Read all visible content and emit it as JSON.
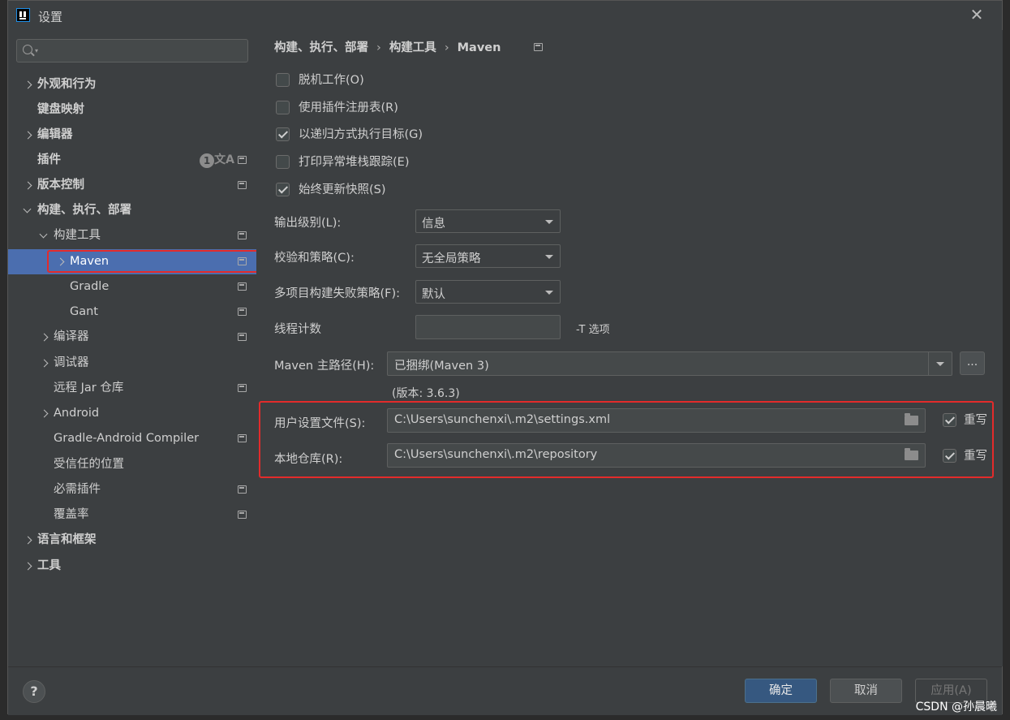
{
  "window": {
    "title": "设置"
  },
  "sidebar": {
    "search_placeholder": "",
    "items": [
      {
        "label": "外观和行为",
        "expand": "right",
        "bold": true
      },
      {
        "label": "键盘映射",
        "expand": "none",
        "bold": true
      },
      {
        "label": "编辑器",
        "expand": "right",
        "bold": true
      },
      {
        "label": "插件",
        "expand": "none",
        "bold": true,
        "badge": "1"
      },
      {
        "label": "版本控制",
        "expand": "right",
        "bold": true
      },
      {
        "label": "构建、执行、部署",
        "expand": "down",
        "bold": true
      },
      {
        "label": "构建工具",
        "expand": "down"
      },
      {
        "label": "Maven",
        "expand": "right",
        "selected": true
      },
      {
        "label": "Gradle",
        "expand": "none"
      },
      {
        "label": "Gant",
        "expand": "none"
      },
      {
        "label": "编译器",
        "expand": "right"
      },
      {
        "label": "调试器",
        "expand": "right"
      },
      {
        "label": "远程 Jar 仓库",
        "expand": "none"
      },
      {
        "label": "Android",
        "expand": "right"
      },
      {
        "label": "Gradle-Android Compiler",
        "expand": "none"
      },
      {
        "label": "受信任的位置",
        "expand": "none"
      },
      {
        "label": "必需插件",
        "expand": "none"
      },
      {
        "label": "覆盖率",
        "expand": "none"
      },
      {
        "label": "语言和框架",
        "expand": "right",
        "bold": true
      },
      {
        "label": "工具",
        "expand": "right",
        "bold": true
      }
    ]
  },
  "breadcrumb": [
    "构建、执行、部署",
    "构建工具",
    "Maven"
  ],
  "checkboxes": [
    {
      "label": "脱机工作(O)",
      "checked": false
    },
    {
      "label": "使用插件注册表(R)",
      "checked": false
    },
    {
      "label": "以递归方式执行目标(G)",
      "checked": true
    },
    {
      "label": "打印异常堆栈跟踪(E)",
      "checked": false
    },
    {
      "label": "始终更新快照(S)",
      "checked": true
    }
  ],
  "fields": {
    "output_level": {
      "label": "输出级别(L):",
      "value": "信息"
    },
    "checksum_policy": {
      "label": "校验和策略(C):",
      "value": "无全局策略"
    },
    "multiproject_fail": {
      "label": "多项目构建失败策略(F):",
      "value": "默认"
    },
    "thread_count": {
      "label": "线程计数",
      "value": "",
      "hint": "-T 选项"
    },
    "maven_home": {
      "label": "Maven 主路径(H):",
      "value": "已捆绑(Maven 3)",
      "browse": "...",
      "version": "(版本: 3.6.3)"
    },
    "user_settings": {
      "label": "用户设置文件(S):",
      "value": "C:\\Users\\sunchenxi\\.m2\\settings.xml",
      "override_label": "重写",
      "override": true
    },
    "local_repo": {
      "label": "本地仓库(R):",
      "value": "C:\\Users\\sunchenxi\\.m2\\repository",
      "override_label": "重写",
      "override": true
    }
  },
  "footer": {
    "ok": "确定",
    "cancel": "取消",
    "apply": "应用(A)",
    "help": "?"
  },
  "watermark": "CSDN @孙晨曦",
  "colors": {
    "background": "#3c3f41",
    "selection": "#4b6eaf",
    "primary_button": "#365880",
    "highlight": "#e32b2b"
  }
}
